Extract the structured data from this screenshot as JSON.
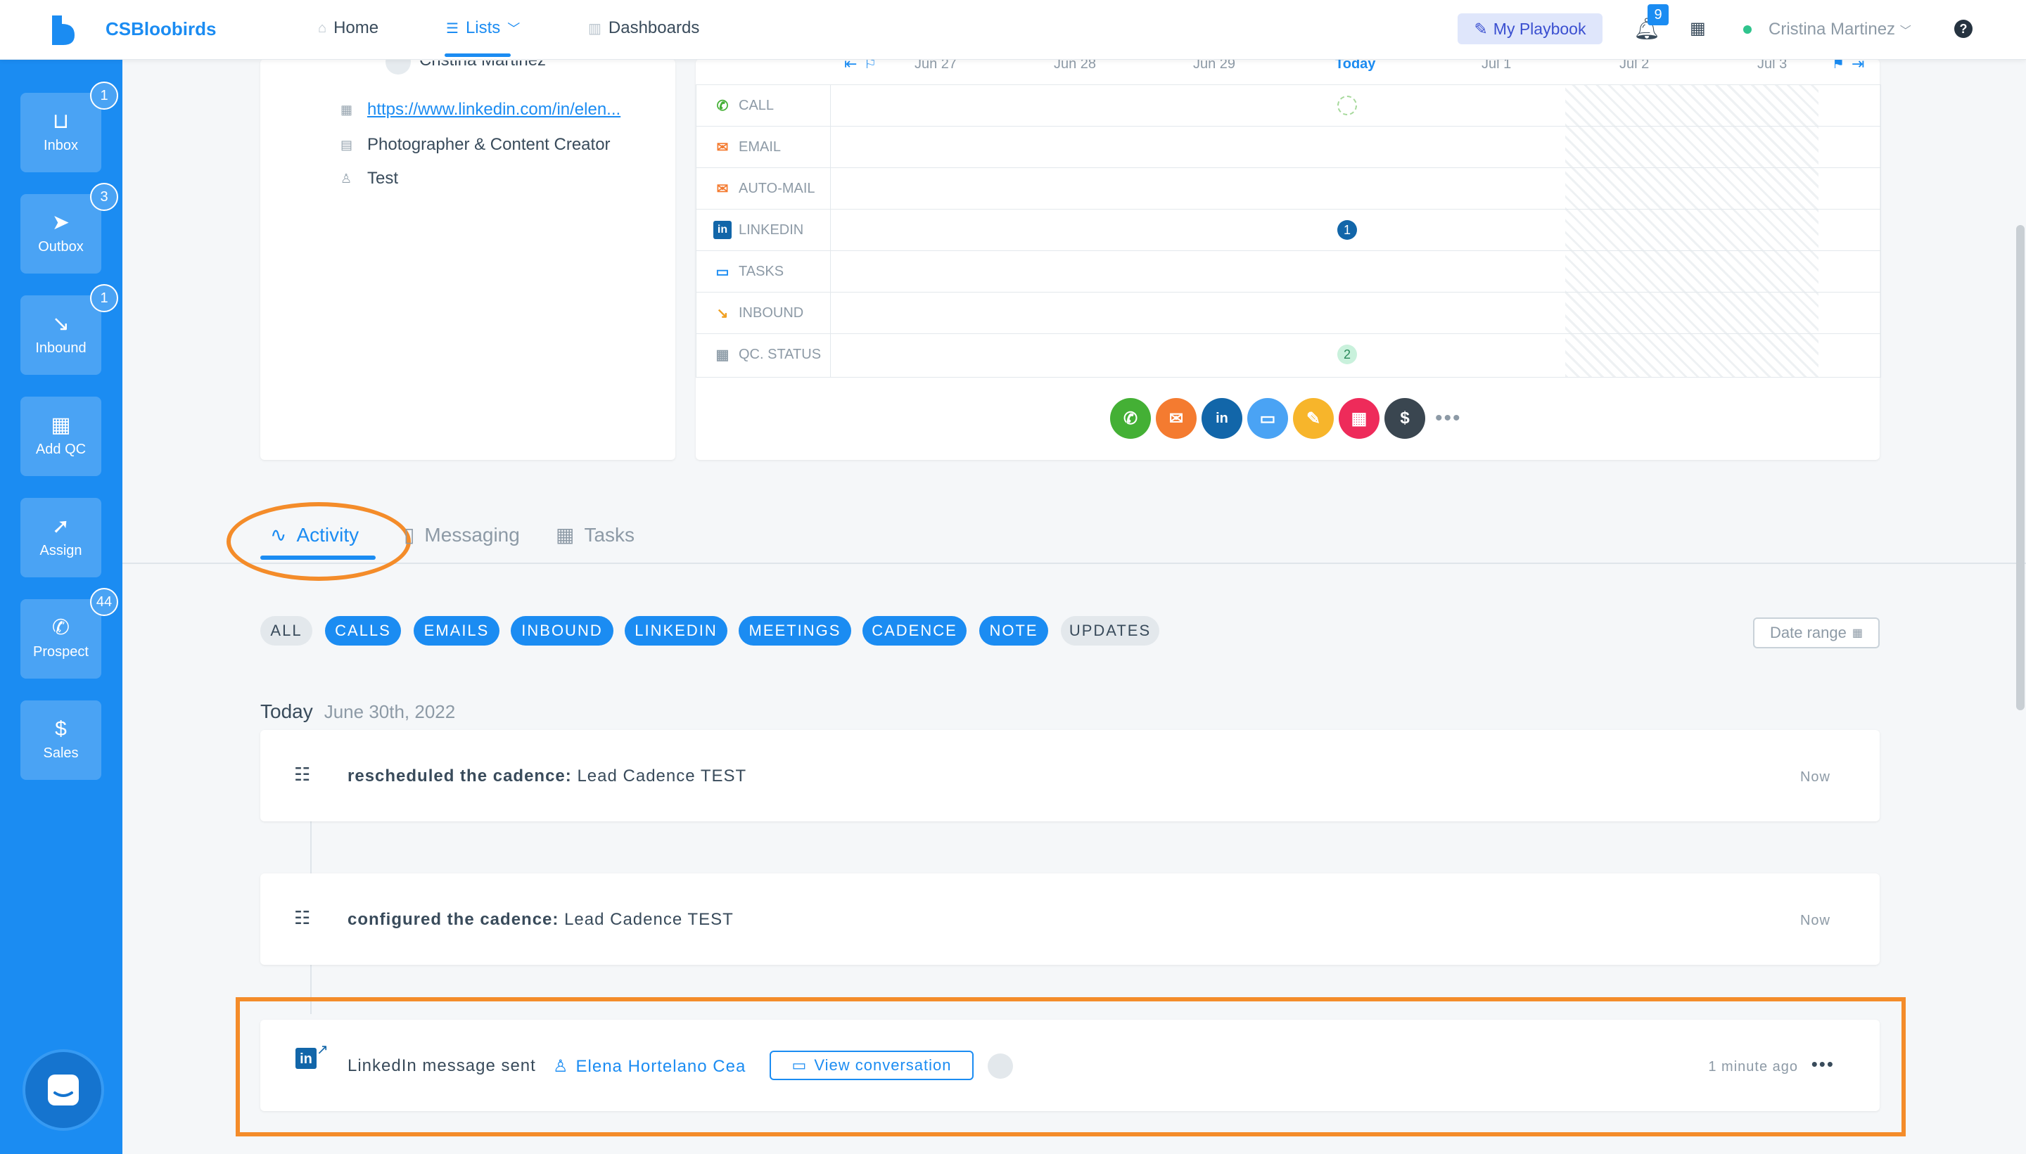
{
  "app": {
    "title": "CSBloobirds",
    "accent": "#1b8cf2"
  },
  "nav": {
    "home": "Home",
    "lists": "Lists",
    "dashboards": "Dashboards"
  },
  "header": {
    "playbook": "My Playbook",
    "notifications_count": "9",
    "user_name": "Cristina Martinez"
  },
  "sidebar": {
    "items": [
      {
        "label": "Inbox",
        "badge": "1",
        "icon": "inbox-icon"
      },
      {
        "label": "Outbox",
        "badge": "3",
        "icon": "send-icon"
      },
      {
        "label": "Inbound",
        "badge": "1",
        "icon": "arrow-in-icon"
      },
      {
        "label": "Add QC",
        "badge": "",
        "icon": "building-icon"
      },
      {
        "label": "Assign",
        "badge": "",
        "icon": "navigate-icon"
      },
      {
        "label": "Prospect",
        "badge": "44",
        "icon": "phone-icon"
      },
      {
        "label": "Sales",
        "badge": "",
        "icon": "dollar-icon"
      }
    ]
  },
  "contact": {
    "name": "Cristina Martinez",
    "linkedin_url": "https://www.linkedin.com/in/elen...",
    "job_title": "Photographer & Content Creator",
    "assignee": "Test"
  },
  "timeline": {
    "dates": [
      "Jun 27",
      "Jun 28",
      "Jun 29",
      "Today",
      "Jul 1",
      "Jul 2",
      "Jul 3"
    ],
    "rows": [
      {
        "label": "CALL",
        "color": "#44b035"
      },
      {
        "label": "EMAIL",
        "color": "#f47b30"
      },
      {
        "label": "AUTO-MAIL",
        "color": "#f47b30"
      },
      {
        "label": "LINKEDIN",
        "color": "#1266a9"
      },
      {
        "label": "TASKS",
        "color": "#1b8cf2"
      },
      {
        "label": "INBOUND",
        "color": "#f0a022"
      },
      {
        "label": "QC. STATUS",
        "color": "#94a2ad"
      }
    ],
    "linkedin_count": "1",
    "qc_count": "2"
  },
  "tabs": {
    "activity": "Activity",
    "messaging": "Messaging",
    "tasks": "Tasks"
  },
  "filters": [
    "ALL",
    "CALLS",
    "EMAILS",
    "INBOUND",
    "LINKEDIN",
    "MEETINGS",
    "CADENCE",
    "NOTE",
    "UPDATES"
  ],
  "date_range": "Date range",
  "day": {
    "label": "Today",
    "date": "June 30th, 2022"
  },
  "activities": [
    {
      "action": "rescheduled the cadence:",
      "target": "Lead Cadence TEST",
      "time": "Now"
    },
    {
      "action": "configured the cadence:",
      "target": "Lead Cadence TEST",
      "time": "Now"
    },
    {
      "action": "LinkedIn message sent",
      "person": "Elena Hortelano Cea",
      "button": "View conversation",
      "time": "1 minute ago"
    }
  ]
}
